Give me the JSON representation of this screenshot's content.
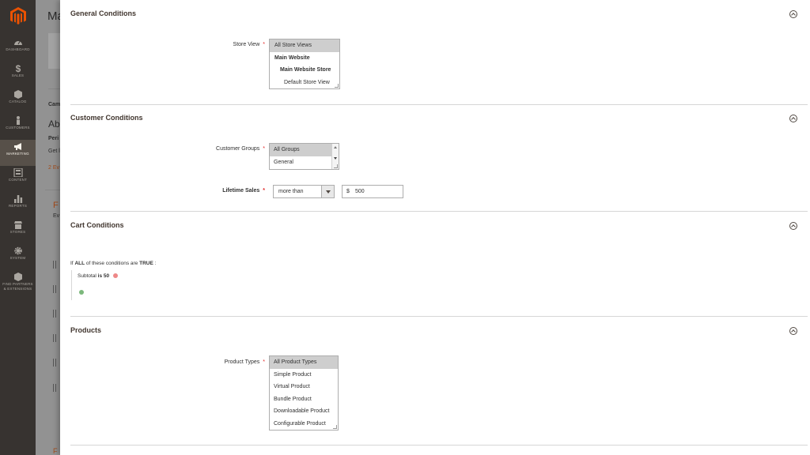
{
  "sidebar": {
    "logo": "magento-logo",
    "items": [
      {
        "label": "DASHBOARD",
        "icon": "dashboard-icon"
      },
      {
        "label": "SALES",
        "icon": "dollar-icon"
      },
      {
        "label": "CATALOG",
        "icon": "cube-icon"
      },
      {
        "label": "CUSTOMERS",
        "icon": "person-icon"
      },
      {
        "label": "MARKETING",
        "icon": "megaphone-icon",
        "active": true
      },
      {
        "label": "CONTENT",
        "icon": "grid-icon"
      },
      {
        "label": "REPORTS",
        "icon": "bar-chart-icon"
      },
      {
        "label": "STORES",
        "icon": "store-icon"
      },
      {
        "label": "SYSTEM",
        "icon": "gear-icon"
      },
      {
        "label": "FIND PARTNERS & EXTENSIONS",
        "icon": "box-icon"
      }
    ]
  },
  "background": {
    "title": "Ma",
    "camp": "Cam",
    "ab": "Ab",
    "peri": "Peri",
    "get": "Get l",
    "events": "2 Ev",
    "f": "F",
    "ev": "Ev",
    "bottom_f": "F"
  },
  "sections": {
    "general": {
      "title": "General Conditions",
      "store_view_label": "Store View",
      "store_view_options": [
        {
          "label": "All Store Views",
          "selected": true,
          "level": 1
        },
        {
          "label": "Main Website",
          "bold": true,
          "level": 1
        },
        {
          "label": "Main Website Store",
          "bold": true,
          "level": 2
        },
        {
          "label": "Default Store View",
          "level": 3
        }
      ]
    },
    "customer": {
      "title": "Customer Conditions",
      "groups_label": "Customer Groups",
      "groups_options": [
        {
          "label": "All Groups",
          "selected": true
        },
        {
          "label": "General"
        }
      ],
      "lifetime_label": "Lifetime Sales",
      "lifetime_operator": "more than",
      "lifetime_currency": "$",
      "lifetime_value": "500"
    },
    "cart": {
      "title": "Cart Conditions",
      "condition_prefix": "If",
      "condition_all": "ALL",
      "condition_middle": "of these conditions are",
      "condition_true": "TRUE",
      "condition_suffix": ":",
      "rule_attr": "Subtotal",
      "rule_op": "is",
      "rule_value": "50"
    },
    "products": {
      "title": "Products",
      "types_label": "Product Types",
      "types_options": [
        {
          "label": "All Product Types",
          "selected": true
        },
        {
          "label": "Simple Product"
        },
        {
          "label": "Virtual Product"
        },
        {
          "label": "Bundle Product"
        },
        {
          "label": "Downloadable Product"
        },
        {
          "label": "Configurable Product"
        }
      ]
    }
  },
  "required_mark": "*",
  "colors": {
    "sidebar": "#373330",
    "sidebar_active": "#575049",
    "logo": "#eb5202",
    "required": "#e22626",
    "overlay": "#929292"
  }
}
